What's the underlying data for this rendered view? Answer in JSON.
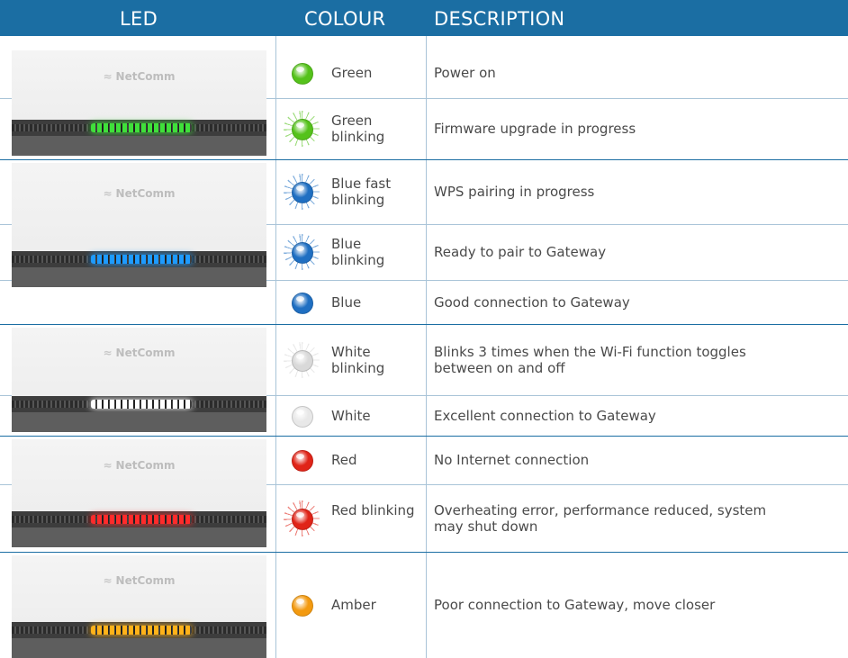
{
  "header": {
    "led": "LED",
    "colour": "COLOUR",
    "description": "DESCRIPTION"
  },
  "brand": "NetComm",
  "rows": [
    {
      "colour": "Green",
      "description": "Power on",
      "led_color": "#55c21b",
      "icon": "green-led-icon"
    },
    {
      "colour": "Green blinking",
      "description": "Firmware upgrade in progress",
      "led_color": "#55c21b",
      "icon": "green-blinking-led-icon"
    },
    {
      "colour": "Blue fast blinking",
      "description": "WPS pairing in progress",
      "led_color": "#1f6fc2",
      "icon": "blue-fast-blinking-led-icon"
    },
    {
      "colour": "Blue blinking",
      "description": "Ready to pair to Gateway",
      "led_color": "#1f6fc2",
      "icon": "blue-blinking-led-icon"
    },
    {
      "colour": "Blue",
      "description": "Good connection to Gateway",
      "led_color": "#1f6fc2",
      "icon": "blue-led-icon"
    },
    {
      "colour": "White blinking",
      "description": "Blinks 3 times when the Wi-Fi function toggles between on and off",
      "led_color": "#d9d9d9",
      "icon": "white-blinking-led-icon"
    },
    {
      "colour": "White",
      "description": "Excellent connection to Gateway",
      "led_color": "#e8e8e8",
      "icon": "white-led-icon"
    },
    {
      "colour": "Red",
      "description": "No Internet connection",
      "led_color": "#e02418",
      "icon": "red-led-icon"
    },
    {
      "colour": "Red blinking",
      "description": "Overheating error, performance reduced, system may shut down",
      "led_color": "#e02418",
      "icon": "red-blinking-led-icon"
    },
    {
      "colour": "Amber",
      "description": "Poor connection to Gateway, move closer",
      "led_color": "#f39a10",
      "icon": "amber-led-icon"
    }
  ],
  "devices": [
    {
      "led_color": "#3fe03a"
    },
    {
      "led_color": "#1e9bff"
    },
    {
      "led_color": "#ffffff"
    },
    {
      "led_color": "#ff2b2b"
    },
    {
      "led_color": "#ffb21a"
    }
  ],
  "colors": {
    "header_bg": "#1b6ea3",
    "grid": "#a9c4d8"
  }
}
